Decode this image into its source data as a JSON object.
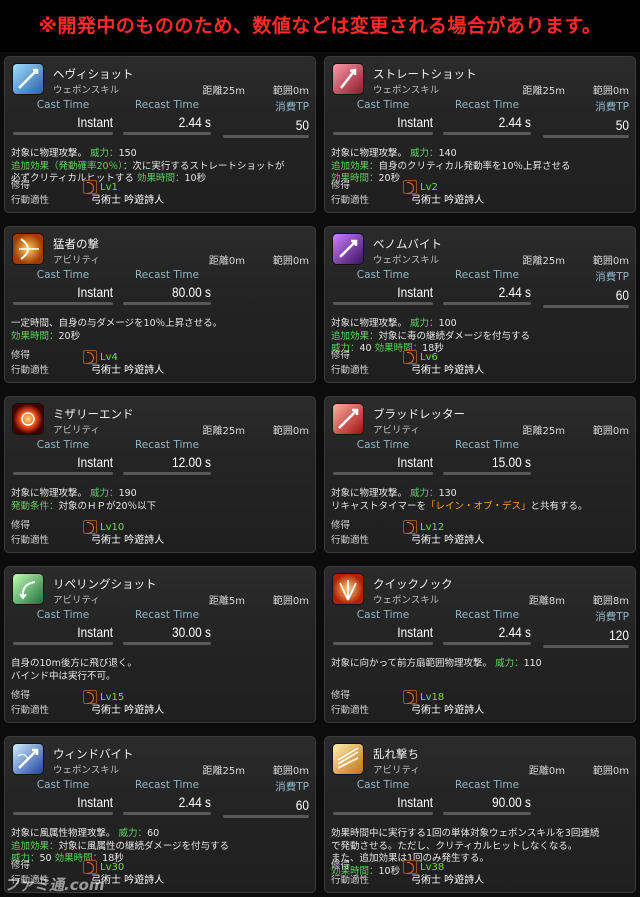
{
  "banner": "※開発中のもののため、数値などは変更される場合があります。",
  "labels": {
    "cast": "Cast Time",
    "recast": "Recast Time",
    "tp": "消費TP",
    "acquire": "修得",
    "aptitude": "行動適性",
    "classes": "弓術士 吟遊詩人"
  },
  "skills": [
    {
      "name": "ヘヴィショット",
      "type": "ウェポンスキル",
      "dist": "距離25m",
      "range": "範囲0m",
      "cast": "Instant",
      "recast": "2.44 s",
      "tp": "50",
      "lv": "Lv1",
      "d1a": "対象に物理攻撃。",
      "d1b": "威力：",
      "d1c": "150",
      "d2a": "追加効果（発動確率20％）",
      "d2b": "：次に実行するストレートショットが",
      "d3a": "必ずクリティカルヒットする",
      "d3b": "効果時間：",
      "d3c": "10秒"
    },
    {
      "name": "ストレートショット",
      "type": "ウェポンスキル",
      "dist": "距離25m",
      "range": "範囲0m",
      "cast": "Instant",
      "recast": "2.44 s",
      "tp": "50",
      "lv": "Lv2",
      "d1a": "対象に物理攻撃。",
      "d1b": "威力：",
      "d1c": "140",
      "d2a": "追加効果：",
      "d2b": "自身のクリティカル発動率を10％上昇させる",
      "d3a": "効果時間：",
      "d3b": "20秒"
    },
    {
      "name": "猛者の撃",
      "type": "アビリティ",
      "dist": "距離0m",
      "range": "範囲0m",
      "cast": "Instant",
      "recast": "80.00 s",
      "tp": "",
      "lv": "Lv4",
      "d1a": "一定時間、自身の与ダメージを10％上昇させる。",
      "d2a": "効果時間：",
      "d2b": "20秒"
    },
    {
      "name": "ベノムバイト",
      "type": "ウェポンスキル",
      "dist": "距離25m",
      "range": "範囲0m",
      "cast": "Instant",
      "recast": "2.44 s",
      "tp": "60",
      "lv": "Lv6",
      "d1a": "対象に物理攻撃。",
      "d1b": "威力：",
      "d1c": "100",
      "d2a": "追加効果：",
      "d2b": "対象に毒の継続ダメージを付与する",
      "d3a": "威力：",
      "d3b": "40",
      "d3c": "効果時間：",
      "d3d": "18秒"
    },
    {
      "name": "ミザリーエンド",
      "type": "アビリティ",
      "dist": "距離25m",
      "range": "範囲0m",
      "cast": "Instant",
      "recast": "12.00 s",
      "tp": "",
      "lv": "Lv10",
      "d1a": "対象に物理攻撃。",
      "d1b": "威力：",
      "d1c": "190",
      "d2a": "発動条件：",
      "d2b": "対象のＨＰが20％以下"
    },
    {
      "name": "ブラッドレッター",
      "type": "アビリティ",
      "dist": "距離25m",
      "range": "範囲0m",
      "cast": "Instant",
      "recast": "15.00 s",
      "tp": "",
      "lv": "Lv12",
      "d1a": "対象に物理攻撃。",
      "d1b": "威力：",
      "d1c": "130",
      "d2a": "リキャストタイマーを",
      "d2b": "「レイン・オブ・デス」",
      "d2c": "と共有する。"
    },
    {
      "name": "リペリングショット",
      "type": "アビリティ",
      "dist": "距離5m",
      "range": "範囲0m",
      "cast": "Instant",
      "recast": "30.00 s",
      "tp": "",
      "lv": "Lv15",
      "d1a": "自身の10m後方に飛び退く。",
      "d2a": "バインド中は実行不可。"
    },
    {
      "name": "クイックノック",
      "type": "ウェポンスキル",
      "dist": "距離8m",
      "range": "範囲8m",
      "cast": "Instant",
      "recast": "2.44 s",
      "tp": "120",
      "lv": "Lv18",
      "d1a": "対象に向かって前方扇範囲物理攻撃。",
      "d1b": "威力：",
      "d1c": "110"
    },
    {
      "name": "ウィンドバイト",
      "type": "ウェポンスキル",
      "dist": "距離25m",
      "range": "範囲0m",
      "cast": "Instant",
      "recast": "2.44 s",
      "tp": "60",
      "lv": "Lv30",
      "d1a": "対象に風属性物理攻撃。",
      "d1b": "威力：",
      "d1c": "60",
      "d2a": "追加効果：",
      "d2b": "対象に風属性の継続ダメージを付与する",
      "d3a": "威力：",
      "d3b": "50",
      "d3c": "効果時間：",
      "d3d": "18秒"
    },
    {
      "name": "乱れ撃ち",
      "type": "アビリティ",
      "dist": "距離0m",
      "range": "範囲0m",
      "cast": "Instant",
      "recast": "90.00 s",
      "tp": "",
      "lv": "Lv38",
      "d1a": "効果時間中に実行する1回の単体対象ウェポンスキルを3回連続",
      "d2a": "で発動させる。ただし、クリティカルヒットしなくなる。",
      "d3a": "また、追加効果は1回のみ発生する。",
      "d4a": "効果時間：",
      "d4b": "10秒"
    }
  ],
  "watermark": "ファミ通.com"
}
